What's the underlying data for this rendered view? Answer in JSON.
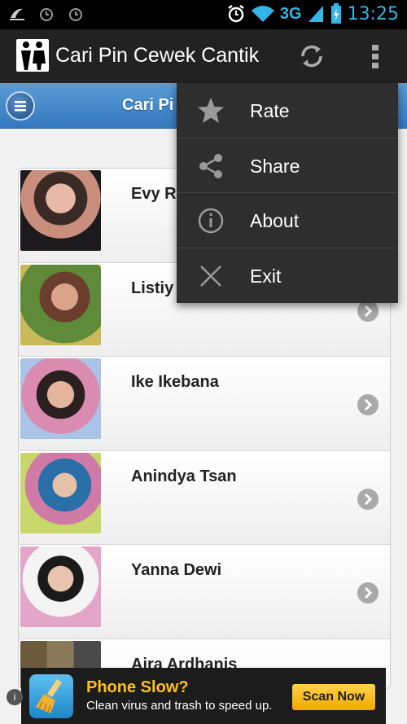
{
  "status_bar": {
    "network": "3G",
    "time": "13:25"
  },
  "action_bar": {
    "title": "Cari Pin Cewek Cantik"
  },
  "header": {
    "title": "Cari Pi"
  },
  "list": {
    "items": [
      {
        "name": "Evy R"
      },
      {
        "name": "Listiy"
      },
      {
        "name": "Ike Ikebana"
      },
      {
        "name": "Anindya Tsan"
      },
      {
        "name": "Yanna Dewi"
      },
      {
        "name": "Aira Ardhanis"
      }
    ]
  },
  "overflow_menu": {
    "items": [
      {
        "label": "Rate",
        "icon": "star-icon"
      },
      {
        "label": "Share",
        "icon": "share-icon"
      },
      {
        "label": "About",
        "icon": "info-icon"
      },
      {
        "label": "Exit",
        "icon": "close-icon"
      }
    ]
  },
  "ad": {
    "headline": "Phone Slow?",
    "subtext": "Clean virus and trash to speed up.",
    "button": "Scan Now"
  },
  "colors": {
    "accent": "#33b5e5",
    "header_blue": "#3479bf",
    "ad_yellow": "#ffbf1e"
  }
}
